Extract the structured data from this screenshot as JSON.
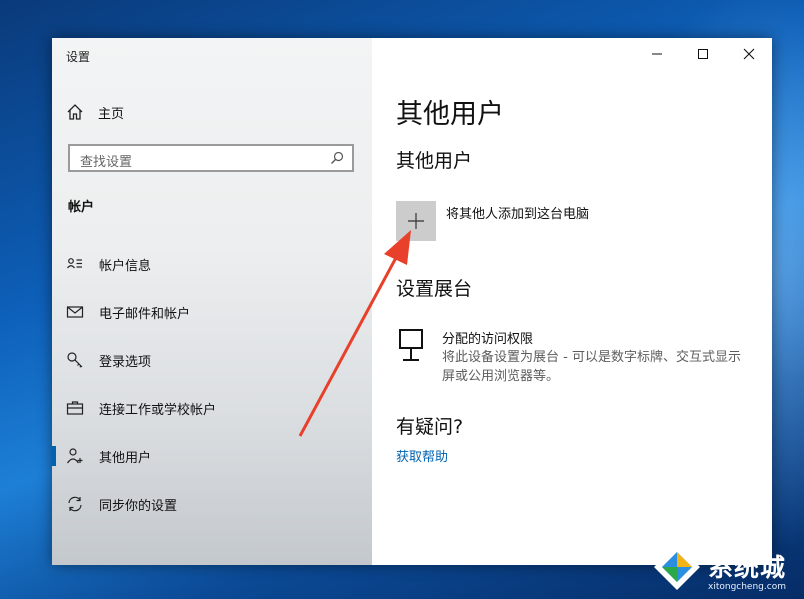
{
  "window": {
    "title": "设置"
  },
  "sidebar": {
    "home_label": "主页",
    "search_placeholder": "查找设置",
    "section_title": "帐户",
    "items": [
      {
        "label": "帐户信息",
        "icon": "user-card-icon",
        "selected": false
      },
      {
        "label": "电子邮件和帐户",
        "icon": "mail-icon",
        "selected": false
      },
      {
        "label": "登录选项",
        "icon": "key-icon",
        "selected": false
      },
      {
        "label": "连接工作或学校帐户",
        "icon": "briefcase-icon",
        "selected": false
      },
      {
        "label": "其他用户",
        "icon": "person-add-icon",
        "selected": true
      },
      {
        "label": "同步你的设置",
        "icon": "sync-icon",
        "selected": false
      }
    ]
  },
  "main": {
    "page_title": "其他用户",
    "section_other": "其他用户",
    "add_label": "将其他人添加到这台电脑",
    "section_kiosk": "设置展台",
    "kiosk_title": "分配的访问权限",
    "kiosk_desc": "将此设备设置为展台 - 可以是数字标牌、交互式显示屏或公用浏览器等。",
    "section_help": "有疑问?",
    "help_link": "获取帮助"
  },
  "watermark": {
    "name": "系统城",
    "url": "xitongcheng.com"
  },
  "colors": {
    "accent": "#0063b1",
    "annotation_arrow": "#e8402a",
    "add_button_bg": "#cccccc"
  }
}
